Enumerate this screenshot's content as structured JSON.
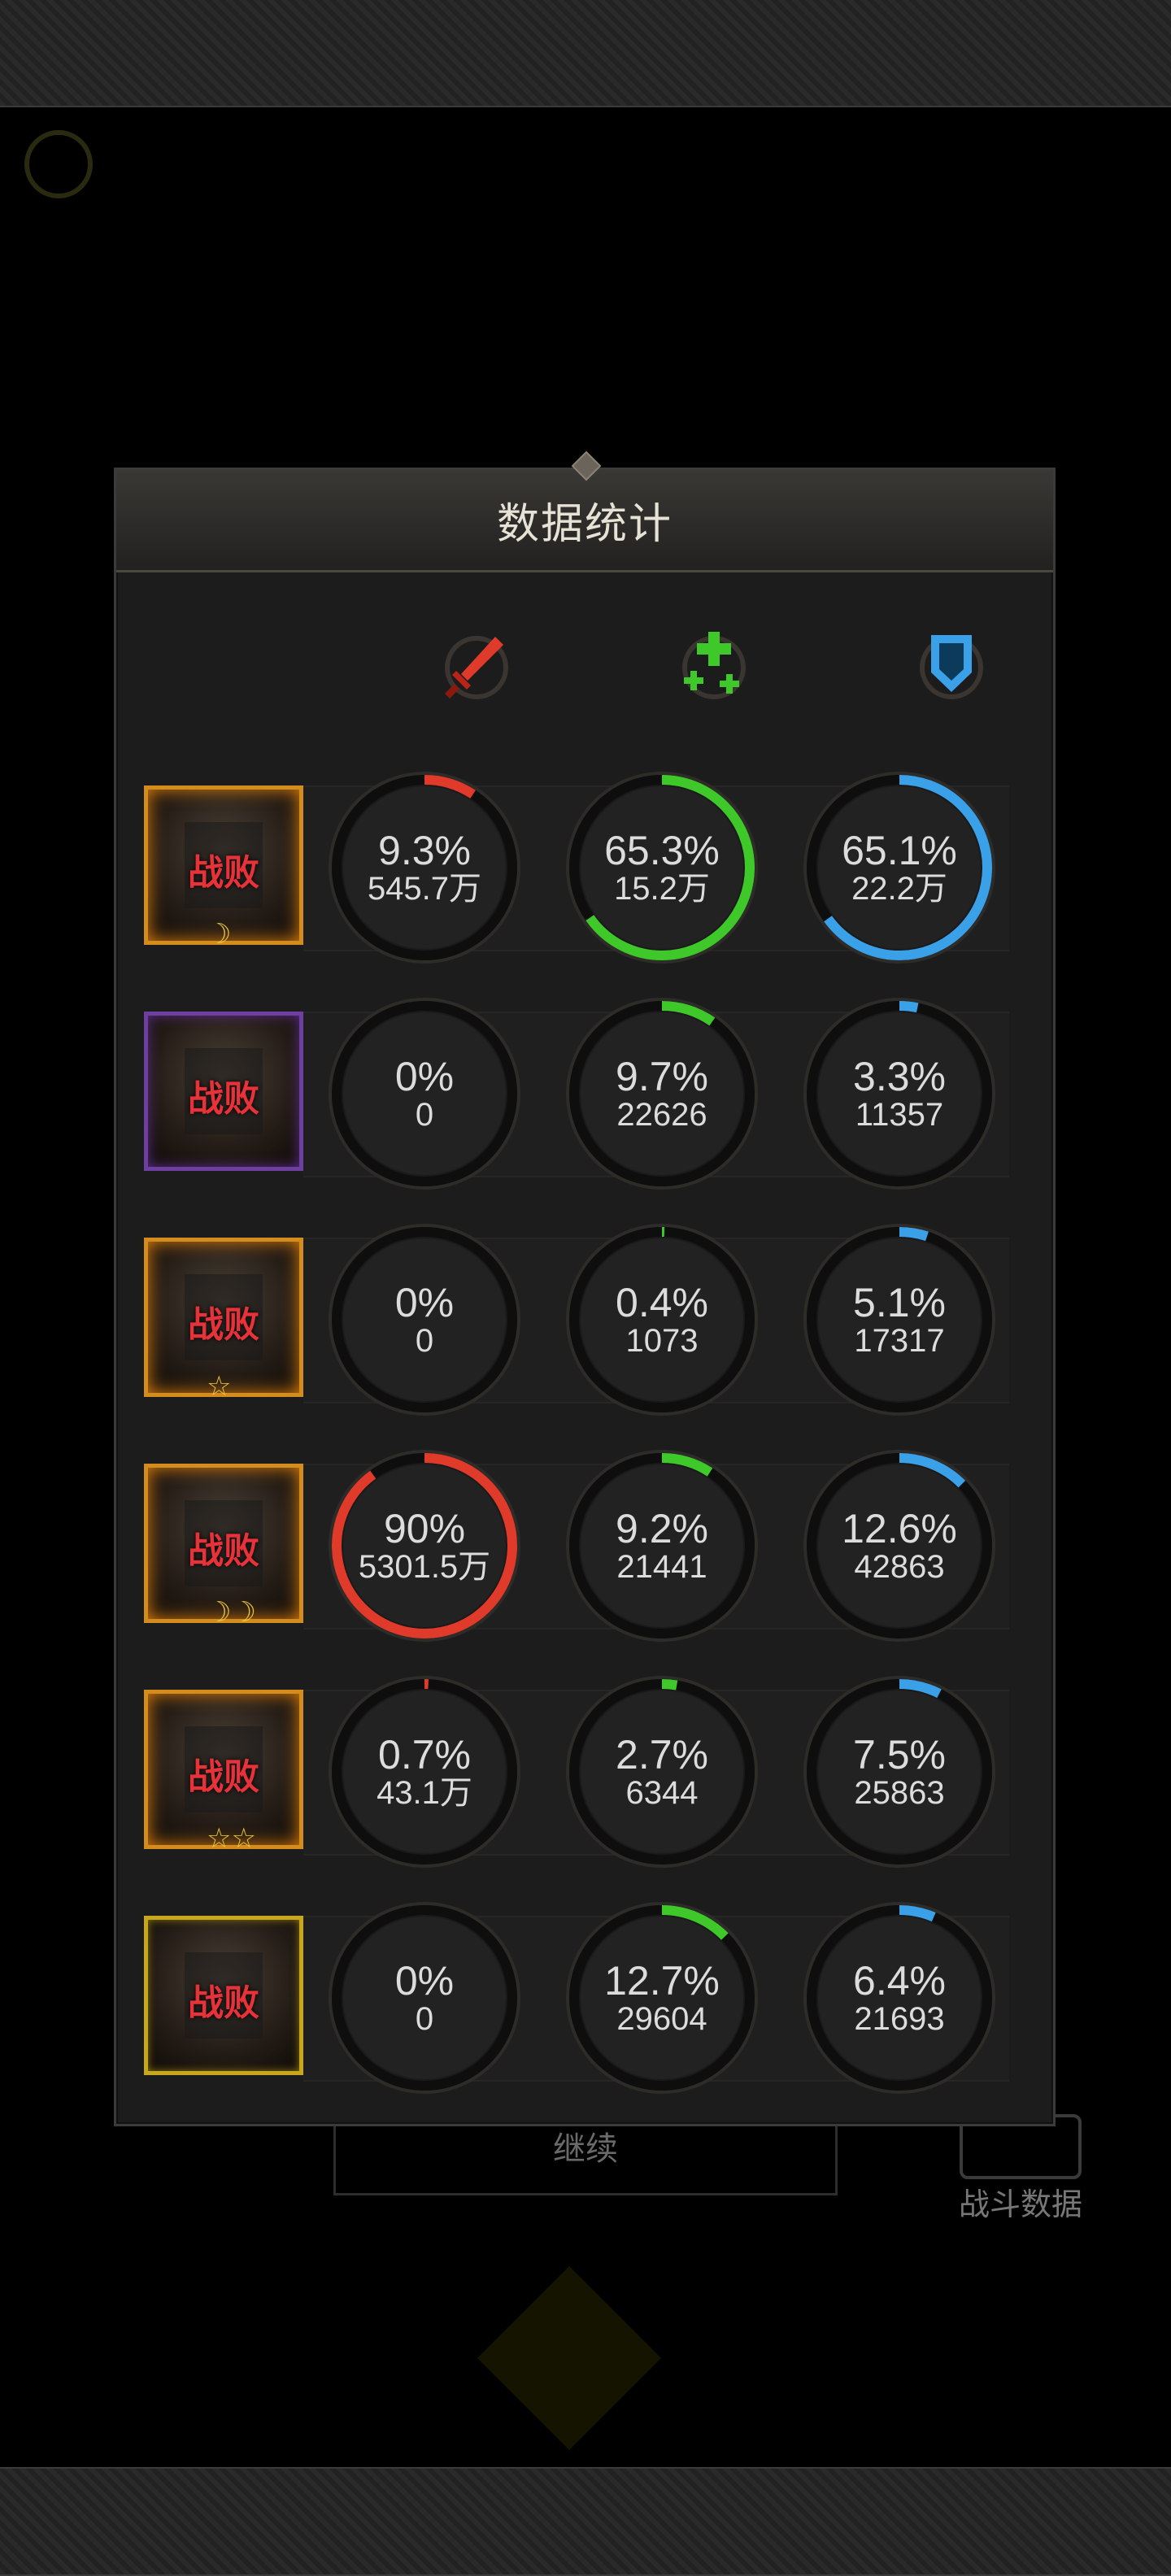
{
  "panel": {
    "title": "数据统计"
  },
  "background": {
    "continue_label": "继续",
    "battle_data_label": "战斗数据"
  },
  "columns": [
    {
      "icon": "sword-icon",
      "color": "#e03a2a"
    },
    {
      "icon": "heal-cross-icon",
      "color": "#3ec82a"
    },
    {
      "icon": "shield-icon",
      "color": "#3aa0e8"
    }
  ],
  "rows": [
    {
      "status": "战败",
      "frame": "orange",
      "badge": "☽",
      "stats": [
        {
          "pct": "9.3%",
          "value": "545.7万",
          "fraction": 0.093
        },
        {
          "pct": "65.3%",
          "value": "15.2万",
          "fraction": 0.653
        },
        {
          "pct": "65.1%",
          "value": "22.2万",
          "fraction": 0.651
        }
      ]
    },
    {
      "status": "战败",
      "frame": "purple",
      "badge": "",
      "stats": [
        {
          "pct": "0%",
          "value": "0",
          "fraction": 0
        },
        {
          "pct": "9.7%",
          "value": "22626",
          "fraction": 0.097
        },
        {
          "pct": "3.3%",
          "value": "11357",
          "fraction": 0.033
        }
      ]
    },
    {
      "status": "战败",
      "frame": "orange",
      "badge": "☆",
      "stats": [
        {
          "pct": "0%",
          "value": "0",
          "fraction": 0
        },
        {
          "pct": "0.4%",
          "value": "1073",
          "fraction": 0.004
        },
        {
          "pct": "5.1%",
          "value": "17317",
          "fraction": 0.051
        }
      ]
    },
    {
      "status": "战败",
      "frame": "orange",
      "badge": "☽☽",
      "stats": [
        {
          "pct": "90%",
          "value": "5301.5万",
          "fraction": 0.9
        },
        {
          "pct": "9.2%",
          "value": "21441",
          "fraction": 0.092
        },
        {
          "pct": "12.6%",
          "value": "42863",
          "fraction": 0.126
        }
      ]
    },
    {
      "status": "战败",
      "frame": "orange",
      "badge": "☆☆",
      "stats": [
        {
          "pct": "0.7%",
          "value": "43.1万",
          "fraction": 0.007
        },
        {
          "pct": "2.7%",
          "value": "6344",
          "fraction": 0.027
        },
        {
          "pct": "7.5%",
          "value": "25863",
          "fraction": 0.075
        }
      ]
    },
    {
      "status": "战败",
      "frame": "gold",
      "badge": "",
      "stats": [
        {
          "pct": "0%",
          "value": "0",
          "fraction": 0
        },
        {
          "pct": "12.7%",
          "value": "29604",
          "fraction": 0.127
        },
        {
          "pct": "6.4%",
          "value": "21693",
          "fraction": 0.064
        }
      ]
    }
  ]
}
